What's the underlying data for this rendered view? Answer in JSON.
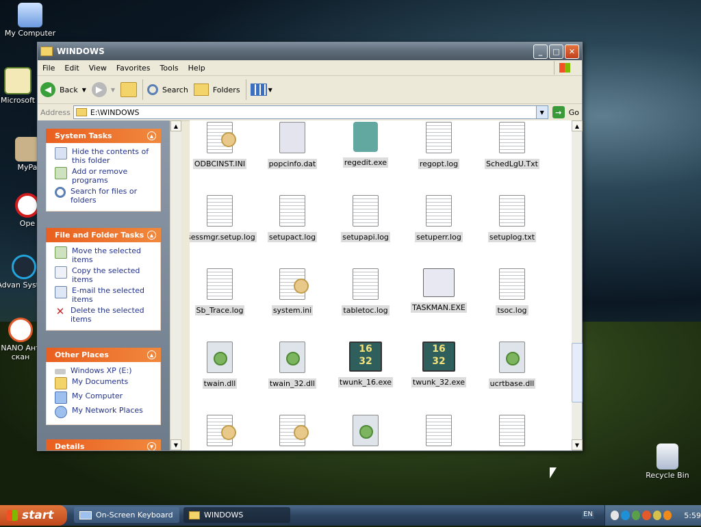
{
  "desktop": {
    "icons": [
      {
        "label": "My Computer"
      },
      {
        "label": "Microsoft"
      },
      {
        "label": "MyPa"
      },
      {
        "label": "Ope"
      },
      {
        "label": "Advan System"
      },
      {
        "label": "NANO Ант скан"
      },
      {
        "label": "Recycle Bin"
      }
    ]
  },
  "window": {
    "title": "WINDOWS",
    "menu": [
      "File",
      "Edit",
      "View",
      "Favorites",
      "Tools",
      "Help"
    ],
    "toolbar": {
      "back": "Back",
      "search": "Search",
      "folders": "Folders"
    },
    "address": {
      "label": "Address",
      "value": "E:\\WINDOWS",
      "go": "Go"
    }
  },
  "taskpane": {
    "system_tasks": {
      "title": "System Tasks",
      "items": [
        "Hide the contents of this folder",
        "Add or remove programs",
        "Search for files or folders"
      ]
    },
    "file_folder_tasks": {
      "title": "File and Folder Tasks",
      "items": [
        "Move the selected items",
        "Copy the selected items",
        "E-mail the selected items",
        "Delete the selected items"
      ]
    },
    "other_places": {
      "title": "Other Places",
      "items": [
        "Windows XP (E:)",
        "My Documents",
        "My Computer",
        "My Network Places"
      ]
    },
    "details": {
      "title": "Details"
    }
  },
  "files": [
    [
      "ODBCINST.INI",
      "popcinfo.dat",
      "regedit.exe",
      "regopt.log",
      "SchedLgU.Txt"
    ],
    [
      "sessmgr.setup.log",
      "setupact.log",
      "setupapi.log",
      "setuperr.log",
      "setuplog.txt"
    ],
    [
      "Sb_Trace.log",
      "system.ini",
      "tabletoc.log",
      "TASKMAN.EXE",
      "tsoc.log"
    ],
    [
      "twain.dll",
      "twain_32.dll",
      "twunk_16.exe",
      "twunk_32.exe",
      "ucrtbase.dll"
    ]
  ],
  "file_icon_text": {
    "top": "16",
    "bottom": "32"
  },
  "taskbar": {
    "start": "start",
    "buttons": [
      "On-Screen Keyboard",
      "WINDOWS"
    ],
    "lang": "EN",
    "clock": "5:59"
  }
}
